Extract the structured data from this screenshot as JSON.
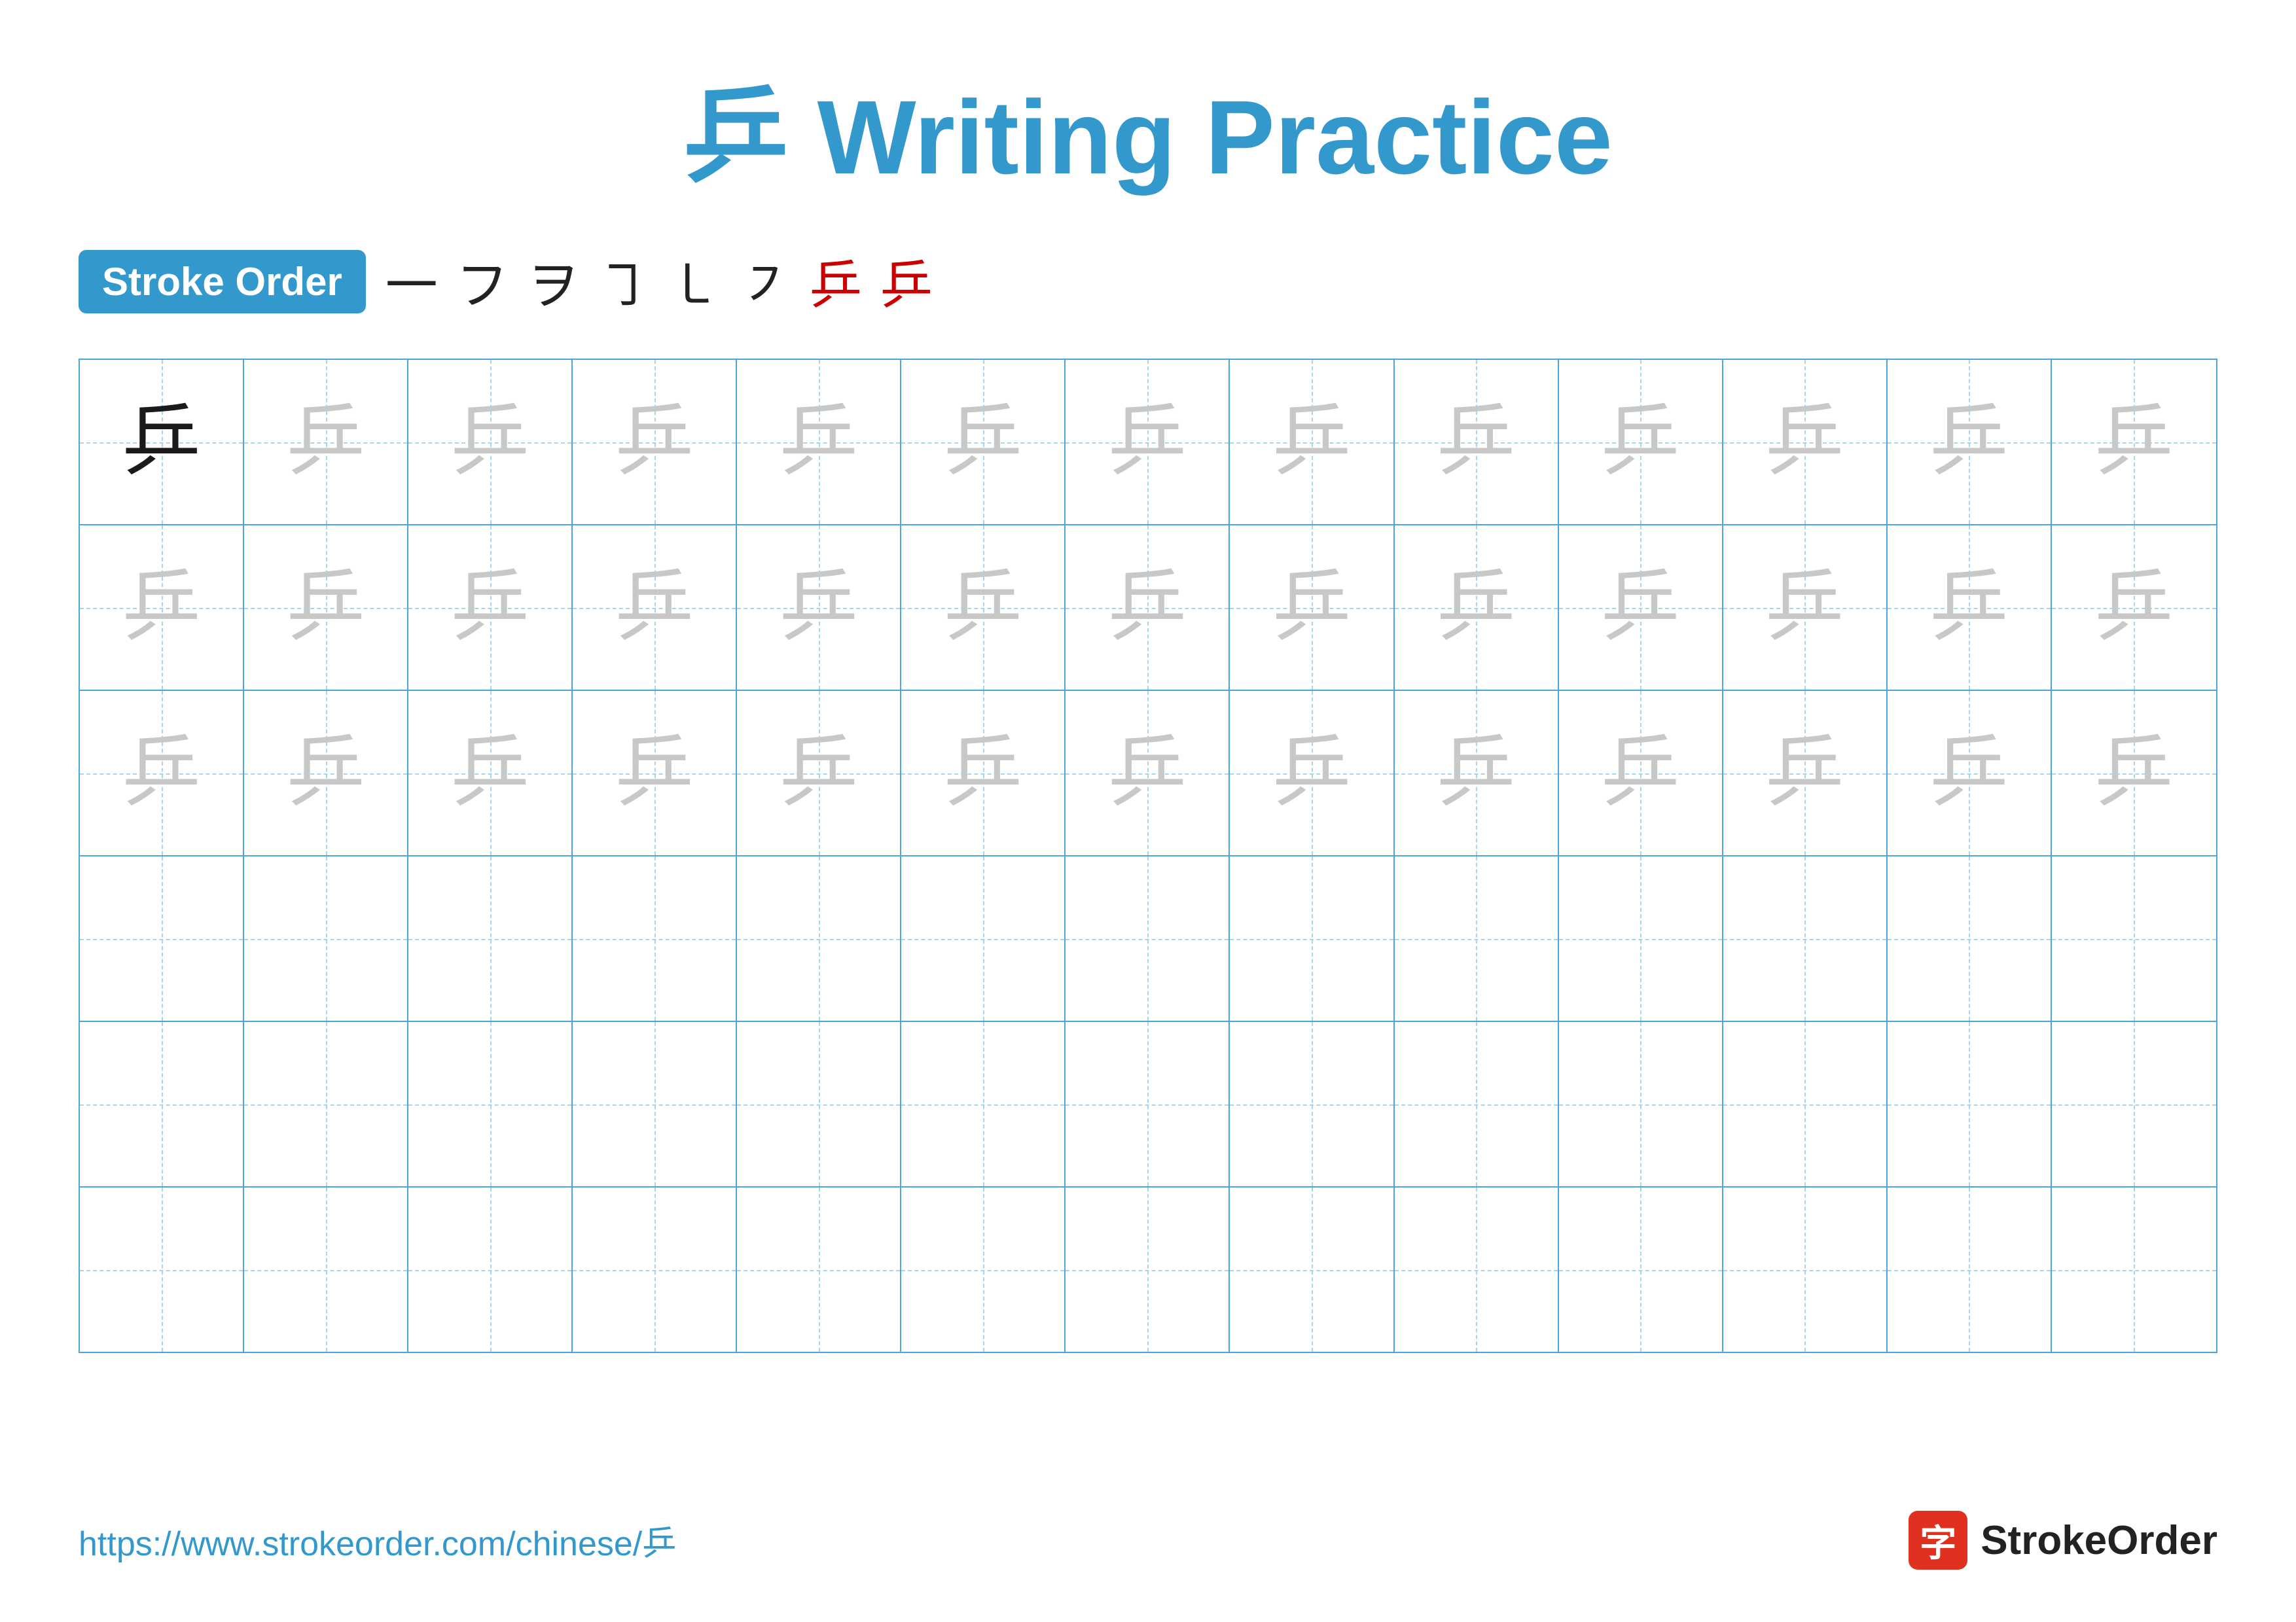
{
  "title": {
    "char": "乒",
    "text": "Writing Practice",
    "full": "乒 Writing Practice"
  },
  "stroke_order": {
    "badge_label": "Stroke Order",
    "strokes": [
      "一",
      "フ",
      "ヲ",
      "㇆",
      "㇄",
      "㇇",
      "乒",
      "乒"
    ],
    "stroke_count": 8
  },
  "grid": {
    "rows": 6,
    "cols": 13,
    "char": "乒",
    "guide_char": "乒"
  },
  "footer": {
    "url": "https://www.strokeorder.com/chinese/乒",
    "brand_name": "StrokeOrder",
    "brand_icon": "字"
  }
}
